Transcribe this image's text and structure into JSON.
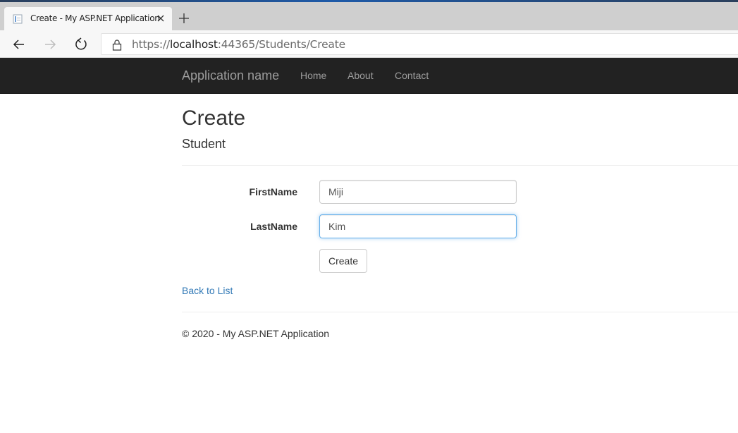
{
  "browser": {
    "tab_title": "Create - My ASP.NET Application",
    "url_scheme": "https://",
    "url_host": "localhost",
    "url_rest": ":44365/Students/Create"
  },
  "navbar": {
    "brand": "Application name",
    "links": [
      "Home",
      "About",
      "Contact"
    ]
  },
  "page": {
    "title": "Create",
    "subtitle": "Student"
  },
  "form": {
    "first_name_label": "FirstName",
    "first_name_value": "Miji",
    "last_name_label": "LastName",
    "last_name_value": "Kim",
    "submit_label": "Create"
  },
  "back_link": "Back to List",
  "footer": "© 2020 - My ASP.NET Application",
  "colors": {
    "navbar_bg": "#222222",
    "link": "#337ab7",
    "focus_border": "#66afe9"
  }
}
